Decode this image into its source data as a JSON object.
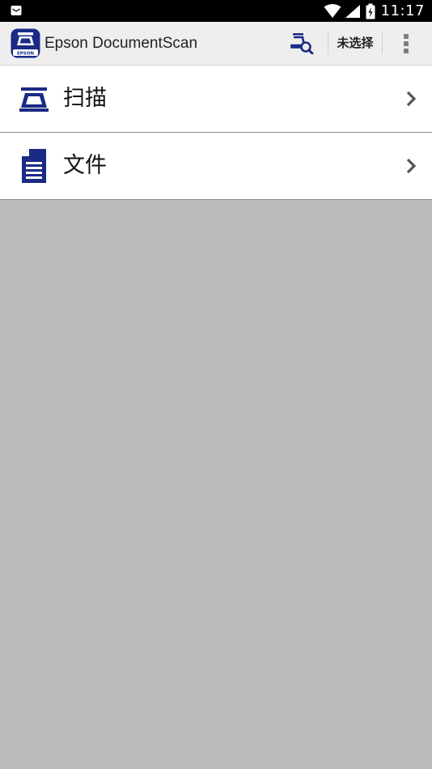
{
  "status_bar": {
    "time": "11:17",
    "notification_icon": "mail-icon",
    "icons": [
      "wifi-icon",
      "cell-signal-icon",
      "battery-icon"
    ]
  },
  "app_bar": {
    "title": "Epson DocumentScan",
    "app_icon_text": "EPSON",
    "scanner_search_icon": "scanner-search-icon",
    "device_label": "未选择",
    "overflow_icon": "more-vertical-icon"
  },
  "menu": {
    "items": [
      {
        "label": "扫描",
        "icon": "scanner-icon"
      },
      {
        "label": "文件",
        "icon": "document-icon"
      }
    ]
  },
  "colors": {
    "accent": "#1a2a86",
    "app_bar_bg": "#eeeeee",
    "content_bg": "#bbbbbb",
    "status_bar_bg": "#000000"
  }
}
